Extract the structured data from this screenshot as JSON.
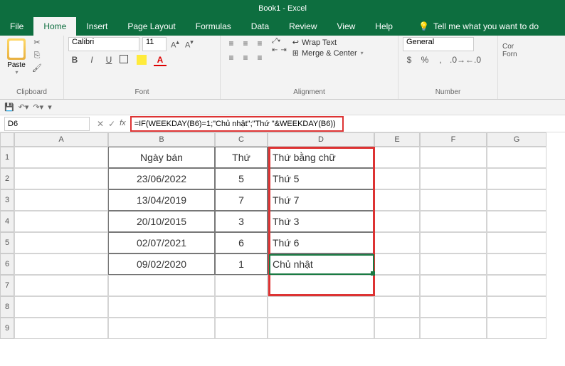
{
  "title": "Book1 - Excel",
  "tabs": [
    "File",
    "Home",
    "Insert",
    "Page Layout",
    "Formulas",
    "Data",
    "Review",
    "View",
    "Help"
  ],
  "tellme": "Tell me what you want to do",
  "ribbon": {
    "clipboard_label": "Clipboard",
    "paste_label": "Paste",
    "font_label": "Font",
    "font_name": "Calibri",
    "font_size": "11",
    "alignment_label": "Alignment",
    "wrap": "Wrap Text",
    "merge": "Merge & Center",
    "number_label": "Number",
    "numfmt": "General"
  },
  "namebox": "D6",
  "formula": "=IF(WEEKDAY(B6)=1;\"Chủ nhật\";\"Thứ \"&WEEKDAY(B6))",
  "columns": [
    "A",
    "B",
    "C",
    "D",
    "E",
    "F",
    "G"
  ],
  "rows": [
    "1",
    "2",
    "3",
    "4",
    "5",
    "6",
    "7",
    "8",
    "9"
  ],
  "sheet": {
    "headers": {
      "B": "Ngày bán",
      "C": "Thứ",
      "D": "Thứ bằng chữ"
    },
    "r2": {
      "B": "23/06/2022",
      "C": "5",
      "D": "Thứ 5"
    },
    "r3": {
      "B": "13/04/2019",
      "C": "7",
      "D": "Thứ 7"
    },
    "r4": {
      "B": "20/10/2015",
      "C": "3",
      "D": "Thứ 3"
    },
    "r5": {
      "B": "02/07/2021",
      "C": "6",
      "D": "Thứ 6"
    },
    "r6": {
      "B": "09/02/2020",
      "C": "1",
      "D": "Chủ nhật"
    }
  }
}
